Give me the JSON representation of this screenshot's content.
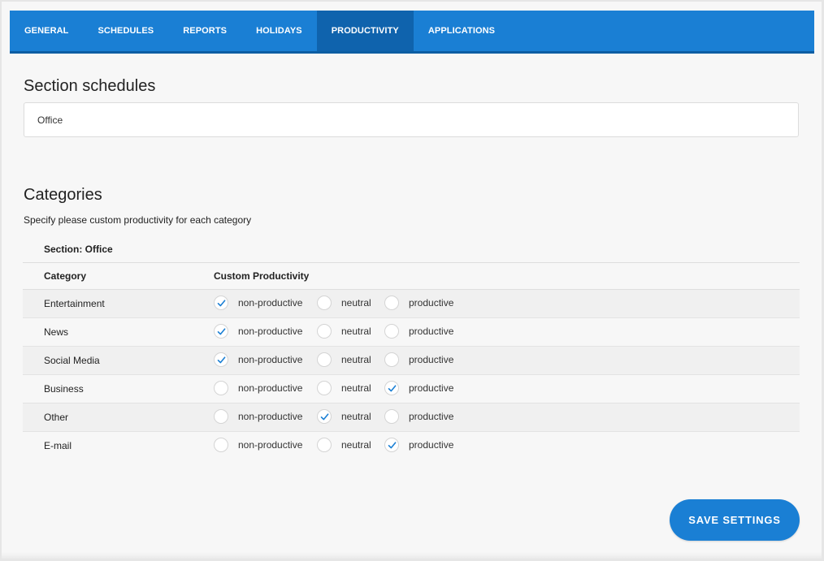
{
  "tabs": [
    {
      "label": "GENERAL",
      "active": false
    },
    {
      "label": "SCHEDULES",
      "active": false
    },
    {
      "label": "REPORTS",
      "active": false
    },
    {
      "label": "HOLIDAYS",
      "active": false
    },
    {
      "label": "PRODUCTIVITY",
      "active": true
    },
    {
      "label": "APPLICATIONS",
      "active": false
    }
  ],
  "schedules": {
    "title": "Section schedules",
    "value": "Office"
  },
  "categories": {
    "title": "Categories",
    "description": "Specify please custom productivity for each category",
    "section_label": "Section: Office",
    "col_category": "Category",
    "col_productivity": "Custom Productivity",
    "option_labels": [
      "non-productive",
      "neutral",
      "productive"
    ],
    "rows": [
      {
        "name": "Entertainment",
        "selected": "non-productive"
      },
      {
        "name": "News",
        "selected": "non-productive"
      },
      {
        "name": "Social Media",
        "selected": "non-productive"
      },
      {
        "name": "Business",
        "selected": "productive"
      },
      {
        "name": "Other",
        "selected": "neutral"
      },
      {
        "name": "E-mail",
        "selected": "productive"
      }
    ]
  },
  "save_button": "SAVE SETTINGS",
  "colors": {
    "accent": "#1a7fd4",
    "accent_dark": "#0f63ad",
    "check": "#1a7fd4"
  }
}
